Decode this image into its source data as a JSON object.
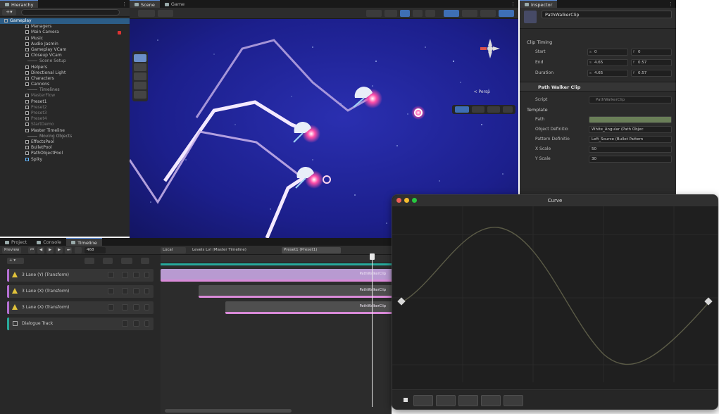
{
  "colors": {
    "selection": "#2c5d87",
    "clip_purple": "#b89ad1",
    "clip_pink": "#d98ad8",
    "track_teal": "#28a99b",
    "scene_blue": "#1b1f8f",
    "curve_line": "#5a5a46"
  },
  "hierarchy": {
    "tab": "Hierarchy",
    "items": [
      {
        "label": "Gameplay",
        "level": 0,
        "kind": "root"
      },
      {
        "label": "Managers",
        "level": 1,
        "kind": "node"
      },
      {
        "label": "Main Camera",
        "level": 1,
        "kind": "node"
      },
      {
        "label": "Music",
        "level": 1,
        "kind": "node"
      },
      {
        "label": "Audio Jasmin",
        "level": 1,
        "kind": "node"
      },
      {
        "label": "Gameplay VCam",
        "level": 1,
        "kind": "node"
      },
      {
        "label": "Closeup VCam",
        "level": 1,
        "kind": "node"
      },
      {
        "label": "Scene Setup",
        "level": 1,
        "kind": "sep"
      },
      {
        "label": "Helpers",
        "level": 1,
        "kind": "node"
      },
      {
        "label": "Directional Light",
        "level": 1,
        "kind": "node"
      },
      {
        "label": "Characters",
        "level": 1,
        "kind": "node"
      },
      {
        "label": "Cannons",
        "level": 1,
        "kind": "node"
      },
      {
        "label": "Timelines",
        "level": 1,
        "kind": "sep"
      },
      {
        "label": "MasterFlow",
        "level": 1,
        "kind": "dim"
      },
      {
        "label": "Preset1",
        "level": 1,
        "kind": "node"
      },
      {
        "label": "Preset2",
        "level": 1,
        "kind": "dim"
      },
      {
        "label": "Preset3",
        "level": 1,
        "kind": "dim"
      },
      {
        "label": "Preset4",
        "level": 1,
        "kind": "dim"
      },
      {
        "label": "StartDemo",
        "level": 1,
        "kind": "dim"
      },
      {
        "label": "Master Timeline",
        "level": 1,
        "kind": "node"
      },
      {
        "label": "Moving Objects",
        "level": 1,
        "kind": "sep"
      },
      {
        "label": "EffectsPool",
        "level": 1,
        "kind": "node"
      },
      {
        "label": "BulletPool",
        "level": 1,
        "kind": "node"
      },
      {
        "label": "PathObjectPool",
        "level": 1,
        "kind": "node"
      },
      {
        "label": "Spiky",
        "level": 1,
        "kind": "prefab"
      }
    ]
  },
  "scene": {
    "tabs": [
      "Scene",
      "Game"
    ],
    "perspective_label": "< Persp"
  },
  "inspector": {
    "tab": "Inspector",
    "object_name": "PathWalkerClip",
    "clip_timing_label": "Clip Timing",
    "timing": [
      {
        "label": "Start",
        "a": "0",
        "b": "0"
      },
      {
        "label": "End",
        "a": "4.65",
        "b": "0.57"
      },
      {
        "label": "Duration",
        "a": "4.65",
        "b": "0.57"
      }
    ],
    "component": "Path Walker Clip",
    "script_label": "Script",
    "script_value": "PathWalkerClip",
    "template_label": "Template",
    "template": [
      {
        "label": "Path",
        "value": ""
      },
      {
        "label": "Object Definitio",
        "value": "White_Angular (Path Objec"
      },
      {
        "label": "Pattern Definitio",
        "value": "Left_Source (Bullet Pattern"
      },
      {
        "label": "X Scale",
        "value": "50"
      },
      {
        "label": "Y Scale",
        "value": "30"
      }
    ]
  },
  "timeline": {
    "tabs": [
      "Project",
      "Console",
      "Timeline"
    ],
    "preview_label": "Preview",
    "frame": "468",
    "local_label": "Local",
    "breadcrumb_1": "Levels Lvl (Master Timeline)",
    "breadcrumb_2": "Preset1 (Preset1)",
    "tracks": [
      {
        "name": "3 Lane (Y) (Transform)",
        "color": "#b36fd1"
      },
      {
        "name": "3 Lane (X) (Transform)",
        "color": "#b36fd1"
      },
      {
        "name": "3 Lane (X) (Transform)",
        "color": "#b36fd1"
      },
      {
        "name": "Dialogue Track",
        "color": "#28a99b"
      }
    ],
    "clips": [
      {
        "label": "PathWalkerClip",
        "row": 0
      },
      {
        "label": "PathWalkerClip",
        "row": 1
      },
      {
        "label": "PathWalkerClip",
        "row": 2
      }
    ]
  },
  "curve": {
    "title": "Curve"
  }
}
